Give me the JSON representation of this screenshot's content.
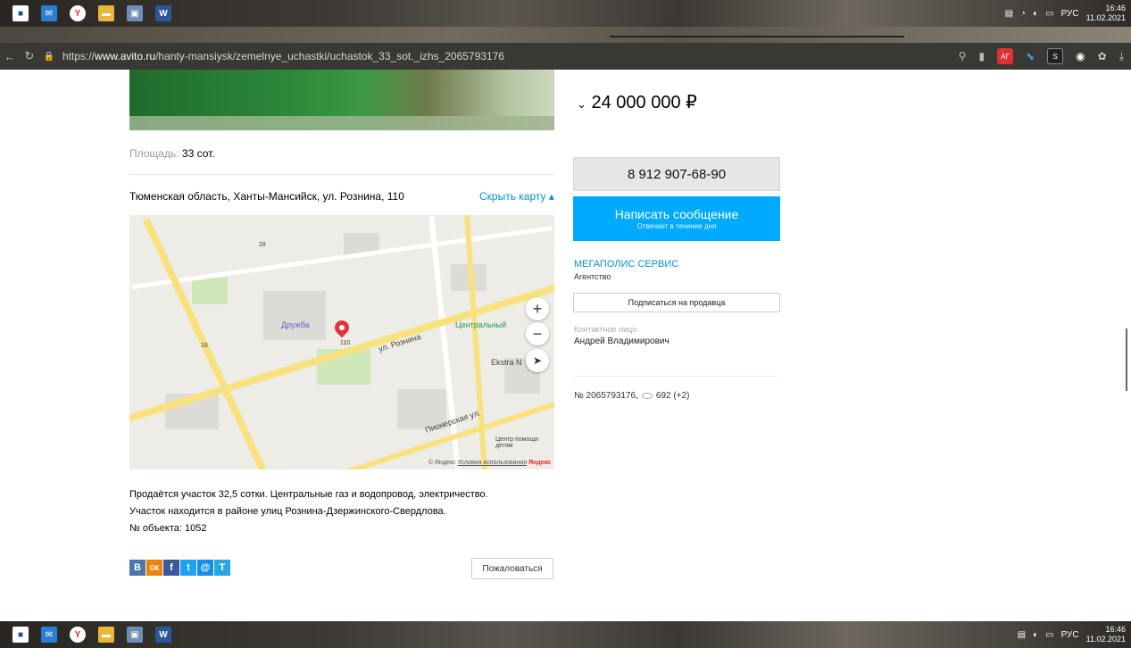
{
  "taskbar": {
    "icons": [
      "windows-logo",
      "mail",
      "yandex-browser",
      "file-explorer",
      "photo-app",
      "word"
    ],
    "lang": "РУС",
    "time": "16:46",
    "date": "11.02.2021"
  },
  "browser": {
    "url_prefix": "https://",
    "url_domain": "www.avito.ru",
    "url_path": "/hanty-mansiysk/zemelnye_uchastki/uchastok_33_sot._izhs_2065793176",
    "ext_ag": "АГ",
    "ext_s": "S"
  },
  "listing": {
    "area_label": "Площадь:",
    "area_value": "33 сот.",
    "address": "Тюменская область, Ханты-Мансийск, ул. Рознина, 110",
    "hide_map": "Скрыть карту",
    "map": {
      "labels": {
        "street_roznina": "ул. Рознина",
        "street_pionerskaya": "Пионерская ул.",
        "poi_druzhba": "Дружба",
        "poi_center": "Центральный",
        "poi_ekstrakon": "Ekstra N",
        "poi_help": "Центр помощи детям",
        "number_110": "110",
        "number_28": "28",
        "number_18": "18"
      },
      "zoom_in": "+",
      "zoom_out": "−",
      "footer_copyright": "© Яндекс",
      "footer_terms": "Условия использования",
      "footer_brand": "Яндекс"
    },
    "description": [
      "Продаётся участок 32,5 сотки. Центральные газ и водопровод, электричество.",
      "Участок находится в районе улиц Рознина-Дзержинского-Свердлова.",
      "№ объекта: 1052"
    ],
    "share": [
      "В",
      "ОК",
      "f",
      "t",
      "@",
      "T"
    ],
    "complain": "Пожаловаться"
  },
  "sidebar": {
    "price": "24 000 000 ₽",
    "phone": "8 912 907-68-90",
    "message_btn": "Написать сообщение",
    "message_sub": "Отвечает в течение дня",
    "seller_name": "МЕГАПОЛИС СЕРВИС",
    "seller_type": "Агентство",
    "subscribe": "Подписаться на продавца",
    "contact_label": "Контактное лицо",
    "contact_name": "Андрей Владимирович",
    "ad_number": "№ 2065793176,",
    "views": "692 (+2)"
  }
}
